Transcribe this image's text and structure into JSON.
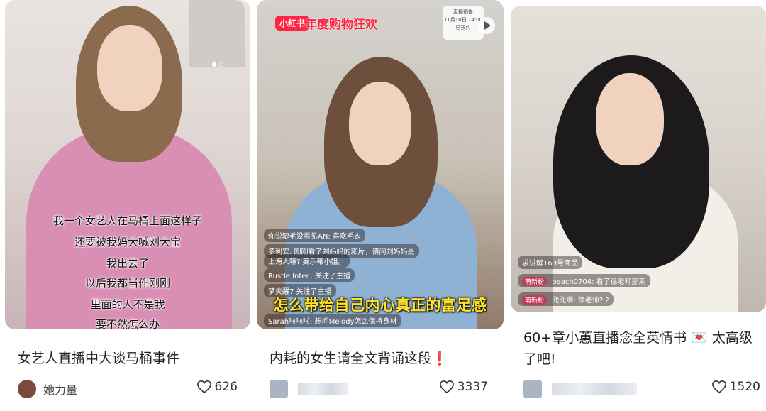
{
  "cards": [
    {
      "subtitles": [
        "我一个女艺人在马桶上面这样子",
        "还要被我妈大喊刘大宝",
        "我出去了",
        "以后我都当作刚刚",
        "里面的人不是我",
        "要不然怎么办"
      ],
      "caption": "女艺人直播中大谈马桶事件",
      "author": "她力量",
      "likes": "626"
    },
    {
      "brand": "小红书",
      "brand_tail": "年度购物狂欢",
      "live_notice": [
        "直播预告",
        "11月10日 14:00",
        "已预约"
      ],
      "chat": [
        "你说睫毛没看见AN: 喜欢毛衣",
        "多利安: 刚刚看了刘妈妈的影片，请问刘妈妈是",
        "上海人嘛? 美乐蒂小姐。",
        "Rustle Inter.. 关注了主播",
        "梦夫醒7 关注了主播",
        "Sarah啦啦啦: 想问Melody怎么保持身材"
      ],
      "big_subtitle": "怎么带给自己内心真正的富足感",
      "caption": "内耗的女生请全文背诵这段❗",
      "likes": "3337"
    },
    {
      "chat": [
        {
          "badge": "",
          "text": "求讲解163号商品"
        },
        {
          "badge": "萌新粉",
          "text": "peach0704: 看了徐老师那期"
        },
        {
          "badge": "萌新粉",
          "text": "兜兜啊: 徐老师? ?"
        }
      ],
      "caption": "60+章小蕙直播念全英情书 💌 太高级了吧!",
      "likes": "1520"
    }
  ],
  "colors": {
    "brand_red": "#ff2442",
    "subtitle_yellow": "#ffe22b"
  },
  "icons": {
    "like": "heart-outline-icon",
    "play": "play-icon"
  }
}
